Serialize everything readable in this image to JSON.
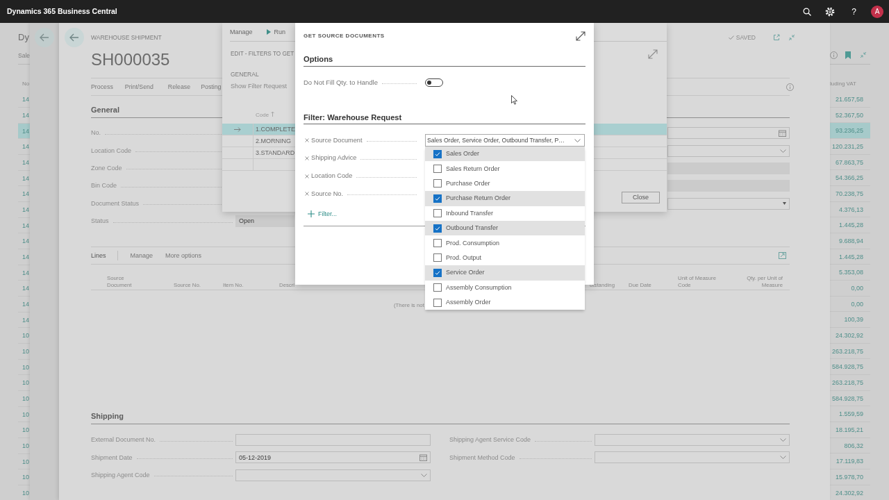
{
  "top_bar": {
    "title": "Dynamics 365 Business Central",
    "help_glyph": "?",
    "avatar_initial": "A"
  },
  "list_page": {
    "title": "Dy",
    "subtitle": "Sale",
    "columns": [
      "No.",
      "luding VAT"
    ],
    "rows": [
      {
        "no": "14",
        "amount": "21.657,58",
        "selected": false
      },
      {
        "no": "14",
        "amount": "52.367,50",
        "selected": false
      },
      {
        "no": "14",
        "amount": "93.236,25",
        "selected": true
      },
      {
        "no": "14",
        "amount": "120.231,25",
        "selected": false
      },
      {
        "no": "14",
        "amount": "67.863,75",
        "selected": false
      },
      {
        "no": "14",
        "amount": "54.366,25",
        "selected": false
      },
      {
        "no": "14",
        "amount": "70.238,75",
        "selected": false
      },
      {
        "no": "14",
        "amount": "4.376,13",
        "selected": false
      },
      {
        "no": "14",
        "amount": "1.445,28",
        "selected": false
      },
      {
        "no": "14",
        "amount": "9.688,94",
        "selected": false
      },
      {
        "no": "14",
        "amount": "1.445,28",
        "selected": false
      },
      {
        "no": "14",
        "amount": "5.353,08",
        "selected": false
      },
      {
        "no": "14",
        "amount": "0,00",
        "selected": false
      },
      {
        "no": "14",
        "amount": "0,00",
        "selected": false
      },
      {
        "no": "14",
        "amount": "100,39",
        "selected": false
      },
      {
        "no": "10",
        "amount": "24.302,92",
        "selected": false
      },
      {
        "no": "10",
        "amount": "263.218,75",
        "selected": false
      },
      {
        "no": "10",
        "amount": "584.928,75",
        "selected": false
      },
      {
        "no": "10",
        "amount": "263.218,75",
        "selected": false
      },
      {
        "no": "10",
        "amount": "584.928,75",
        "selected": false
      },
      {
        "no": "10",
        "amount": "1.559,59",
        "selected": false
      },
      {
        "no": "10",
        "amount": "18.195,21",
        "selected": false
      },
      {
        "no": "10",
        "amount": "806,32",
        "selected": false
      },
      {
        "no": "10",
        "amount": "17.119,83",
        "selected": false
      },
      {
        "no": "10",
        "amount": "15.978,70",
        "selected": false
      },
      {
        "no": "10",
        "amount": "24.302,92",
        "selected": false
      }
    ]
  },
  "shipment_card": {
    "caption": "WAREHOUSE SHIPMENT",
    "saved_label": "SAVED",
    "number": "SH000035",
    "actions": [
      "Process",
      "Print/Send",
      "Release",
      "Posting"
    ],
    "general": {
      "title": "General",
      "fields": [
        {
          "label": "No."
        },
        {
          "label": "Location Code"
        },
        {
          "label": "Zone Code"
        },
        {
          "label": "Bin Code"
        },
        {
          "label": "Document Status"
        },
        {
          "label": "Status",
          "value": "Open"
        }
      ],
      "right_fields": [
        {
          "kind": "date"
        },
        {
          "kind": "dropdown"
        },
        {
          "kind": "readonly"
        },
        {
          "kind": "readonly"
        },
        {
          "kind": "select"
        }
      ]
    },
    "lines": {
      "title": "Lines",
      "actions": [
        "Manage",
        "More options"
      ],
      "columns": [
        "Source Document",
        "Source No.",
        "Item No.",
        "Descri",
        "utstanding",
        "Due Date",
        "Unit of Measure Code",
        "Qty. per Unit of Measure"
      ],
      "empty_text": "(There is not"
    },
    "shipping": {
      "title": "Shipping",
      "left_fields": [
        {
          "label": "External Document No.",
          "kind": "text"
        },
        {
          "label": "Shipment Date",
          "kind": "date",
          "value": "05-12-2019"
        },
        {
          "label": "Shipping Agent Code",
          "kind": "dropdown"
        }
      ],
      "right_fields": [
        {
          "label": "Shipping Agent Service Code",
          "kind": "dropdown"
        },
        {
          "label": "Shipment Method Code",
          "kind": "dropdown"
        }
      ]
    }
  },
  "filters_dialog": {
    "actions": [
      "Manage",
      "Run"
    ],
    "title": "EDIT - FILTERS TO GET",
    "group": "GENERAL",
    "link": "Show Filter Request",
    "column": "Code",
    "rows": [
      {
        "code": "1.COMPLETE",
        "selected": true
      },
      {
        "code": "2.MORNING",
        "selected": false
      },
      {
        "code": "3.STANDARD",
        "selected": false
      }
    ],
    "close_button": "Close"
  },
  "source_dialog": {
    "title": "GET SOURCE DOCUMENTS",
    "options_title": "Options",
    "options": [
      {
        "label": "Do Not Fill Qty. to Handle",
        "on": false
      }
    ],
    "filter_title": "Filter: Warehouse Request",
    "filters": [
      {
        "label": "Source Document",
        "value": "Sales Order, Service Order, Outbound Transfer, P…"
      },
      {
        "label": "Shipping Advice"
      },
      {
        "label": "Location Code"
      },
      {
        "label": "Source No."
      }
    ],
    "add_filter": "Filter...",
    "dropdown": {
      "items": [
        {
          "label": "Sales Order",
          "checked": true
        },
        {
          "label": "Sales Return Order",
          "checked": false
        },
        {
          "label": "Purchase Order",
          "checked": false
        },
        {
          "label": "Purchase Return Order",
          "checked": true
        },
        {
          "label": "Inbound Transfer",
          "checked": false
        },
        {
          "label": "Outbound Transfer",
          "checked": true
        },
        {
          "label": "Prod. Consumption",
          "checked": false
        },
        {
          "label": "Prod. Output",
          "checked": false
        },
        {
          "label": "Service Order",
          "checked": true
        },
        {
          "label": "Assembly Consumption",
          "checked": false
        },
        {
          "label": "Assembly Order",
          "checked": false
        }
      ]
    }
  }
}
